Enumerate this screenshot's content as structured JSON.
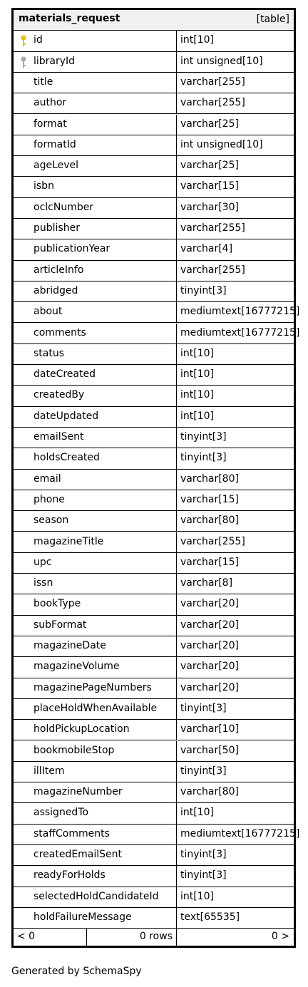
{
  "table": {
    "name": "materials_request",
    "kind": "[table]",
    "columns": [
      {
        "name": "id",
        "type": "int[10]",
        "key": "primary"
      },
      {
        "name": "libraryId",
        "type": "int unsigned[10]",
        "key": "foreign"
      },
      {
        "name": "title",
        "type": "varchar[255]"
      },
      {
        "name": "author",
        "type": "varchar[255]"
      },
      {
        "name": "format",
        "type": "varchar[25]"
      },
      {
        "name": "formatId",
        "type": "int unsigned[10]"
      },
      {
        "name": "ageLevel",
        "type": "varchar[25]"
      },
      {
        "name": "isbn",
        "type": "varchar[15]"
      },
      {
        "name": "oclcNumber",
        "type": "varchar[30]"
      },
      {
        "name": "publisher",
        "type": "varchar[255]"
      },
      {
        "name": "publicationYear",
        "type": "varchar[4]"
      },
      {
        "name": "articleInfo",
        "type": "varchar[255]"
      },
      {
        "name": "abridged",
        "type": "tinyint[3]"
      },
      {
        "name": "about",
        "type": "mediumtext[16777215]"
      },
      {
        "name": "comments",
        "type": "mediumtext[16777215]"
      },
      {
        "name": "status",
        "type": "int[10]"
      },
      {
        "name": "dateCreated",
        "type": "int[10]"
      },
      {
        "name": "createdBy",
        "type": "int[10]"
      },
      {
        "name": "dateUpdated",
        "type": "int[10]"
      },
      {
        "name": "emailSent",
        "type": "tinyint[3]"
      },
      {
        "name": "holdsCreated",
        "type": "tinyint[3]"
      },
      {
        "name": "email",
        "type": "varchar[80]"
      },
      {
        "name": "phone",
        "type": "varchar[15]"
      },
      {
        "name": "season",
        "type": "varchar[80]"
      },
      {
        "name": "magazineTitle",
        "type": "varchar[255]"
      },
      {
        "name": "upc",
        "type": "varchar[15]"
      },
      {
        "name": "issn",
        "type": "varchar[8]"
      },
      {
        "name": "bookType",
        "type": "varchar[20]"
      },
      {
        "name": "subFormat",
        "type": "varchar[20]"
      },
      {
        "name": "magazineDate",
        "type": "varchar[20]"
      },
      {
        "name": "magazineVolume",
        "type": "varchar[20]"
      },
      {
        "name": "magazinePageNumbers",
        "type": "varchar[20]"
      },
      {
        "name": "placeHoldWhenAvailable",
        "type": "tinyint[3]"
      },
      {
        "name": "holdPickupLocation",
        "type": "varchar[10]"
      },
      {
        "name": "bookmobileStop",
        "type": "varchar[50]"
      },
      {
        "name": "illItem",
        "type": "tinyint[3]"
      },
      {
        "name": "magazineNumber",
        "type": "varchar[80]"
      },
      {
        "name": "assignedTo",
        "type": "int[10]"
      },
      {
        "name": "staffComments",
        "type": "mediumtext[16777215]"
      },
      {
        "name": "createdEmailSent",
        "type": "tinyint[3]"
      },
      {
        "name": "readyForHolds",
        "type": "tinyint[3]"
      },
      {
        "name": "selectedHoldCandidateId",
        "type": "int[10]"
      },
      {
        "name": "holdFailureMessage",
        "type": "text[65535]"
      }
    ],
    "footer": {
      "parents": "< 0",
      "rows": "0 rows",
      "children": "0 >"
    }
  },
  "icons": {
    "primary_key": "key-icon",
    "foreign_key": "foreign-key-icon"
  },
  "colors": {
    "primary_key": "#e8c400",
    "foreign_key": "#a8a8a8",
    "header_bg": "#f0f0f0"
  },
  "generated_by": "Generated by SchemaSpy"
}
